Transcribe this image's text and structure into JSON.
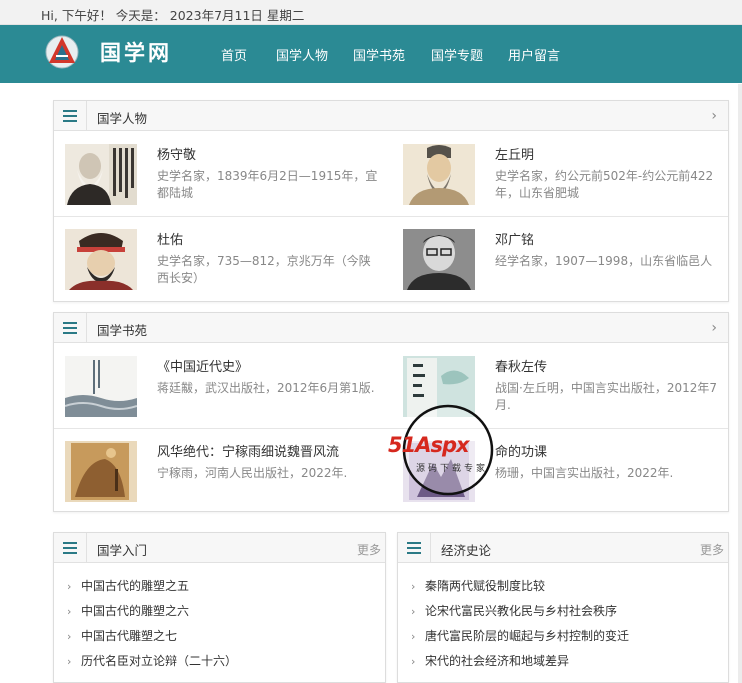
{
  "topbar": {
    "greeting": "Hi, 下午好！ 今天是： 2023年7月11日 星期二"
  },
  "header": {
    "logo_text": "国学网",
    "nav": [
      "首页",
      "国学人物",
      "国学书苑",
      "国学专题",
      "用户留言"
    ]
  },
  "people": {
    "title": "国学人物",
    "items": [
      {
        "name": "杨守敬",
        "desc": "史学名家，1839年6月2日—1915年，宜都陆城"
      },
      {
        "name": "左丘明",
        "desc": "史学名家，约公元前502年-约公元前422年，山东省肥城"
      },
      {
        "name": "杜佑",
        "desc": "史学名家，735—812，京兆万年（今陕西长安）"
      },
      {
        "name": "邓广铭",
        "desc": "经学名家，1907—1998，山东省临邑人"
      }
    ]
  },
  "books": {
    "title": "国学书苑",
    "items": [
      {
        "name": "《中国近代史》",
        "desc": "蒋廷黻，武汉出版社，2012年6月第1版."
      },
      {
        "name": "春秋左传",
        "desc": "战国·左丘明，中国言实出版社，2012年7月."
      },
      {
        "name": "风华绝代：宁稼雨细说魏晋风流",
        "desc": "宁稼雨，河南人民出版社，2022年."
      },
      {
        "name": "命的功课",
        "desc": "杨珊，中国言实出版社，2022年."
      }
    ]
  },
  "intro": {
    "title": "国学入门",
    "more": "更多",
    "links": [
      "中国古代的雕塑之五",
      "中国古代的雕塑之六",
      "中国古代雕塑之七",
      "历代名臣对立论辩（二十六）"
    ]
  },
  "econ": {
    "title": "经济史论",
    "more": "更多",
    "links": [
      "秦隋两代赋役制度比较",
      "论宋代富民兴教化民与乡村社会秩序",
      "唐代富民阶层的崛起与乡村控制的变迁",
      "宋代的社会经济和地域差异"
    ]
  },
  "watermark": {
    "brand": "51Aspx",
    "sub": "源码下载专家"
  },
  "colors": {
    "header": "#2b8a94",
    "accent": "#2b7a86"
  }
}
